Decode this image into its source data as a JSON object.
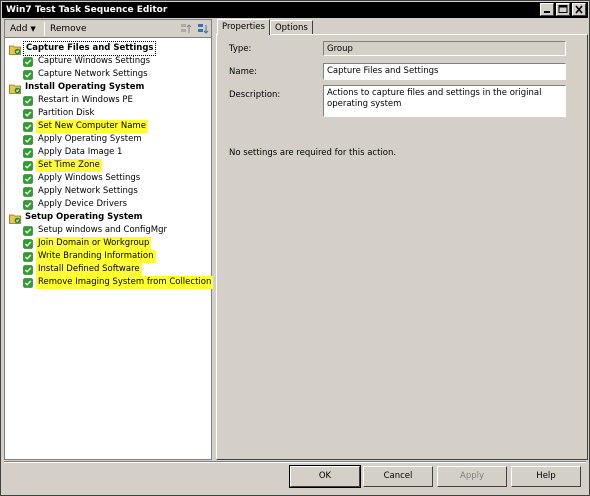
{
  "window": {
    "title": "Win7 Test Task Sequence Editor"
  },
  "toolbar": {
    "add_label": "Add",
    "remove_label": "Remove"
  },
  "tree": {
    "groups": [
      {
        "label": "Capture Files and Settings",
        "items": [
          {
            "label": "Capture Windows Settings",
            "highlight": false
          },
          {
            "label": "Capture Network Settings",
            "highlight": false
          }
        ]
      },
      {
        "label": "Install Operating System",
        "items": [
          {
            "label": "Restart in Windows PE",
            "highlight": false
          },
          {
            "label": "Partition Disk",
            "highlight": false
          },
          {
            "label": "Set New Computer Name",
            "highlight": true
          },
          {
            "label": "Apply Operating System",
            "highlight": false
          },
          {
            "label": "Apply Data Image 1",
            "highlight": false
          },
          {
            "label": "Set Time Zone",
            "highlight": true
          },
          {
            "label": "Apply Windows Settings",
            "highlight": false
          },
          {
            "label": "Apply Network Settings",
            "highlight": false
          },
          {
            "label": "Apply Device Drivers",
            "highlight": false
          }
        ]
      },
      {
        "label": "Setup Operating System",
        "items": [
          {
            "label": "Setup windows and ConfigMgr",
            "highlight": false
          },
          {
            "label": "Join Domain or Workgroup",
            "highlight": true
          },
          {
            "label": "Write Branding Information",
            "highlight": true
          },
          {
            "label": "Install Defined Software",
            "highlight": true
          },
          {
            "label": "Remove Imaging System from Collection",
            "highlight": true
          }
        ]
      }
    ]
  },
  "tabs": {
    "properties": "Properties",
    "options": "Options"
  },
  "properties": {
    "type_label": "Type:",
    "type_value": "Group",
    "name_label": "Name:",
    "name_value": "Capture Files and Settings",
    "description_label": "Description:",
    "description_value": "Actions to capture files and settings in the original operating system",
    "note": "No settings are required  for this action."
  },
  "buttons": {
    "ok": "OK",
    "cancel": "Cancel",
    "apply": "Apply",
    "help": "Help"
  },
  "colors": {
    "highlight": "#ffff33",
    "check_green": "#2e9e2e",
    "folder_yellow": "#e8c84a"
  }
}
